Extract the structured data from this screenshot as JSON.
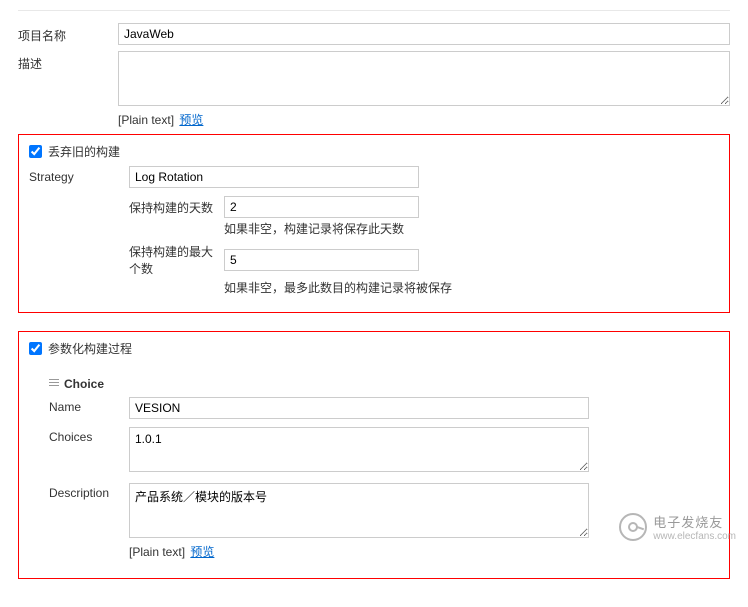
{
  "projectName": {
    "label": "项目名称",
    "value": "JavaWeb"
  },
  "description": {
    "label": "描述",
    "value": ""
  },
  "plainText": "[Plain text]",
  "previewLink": "预览",
  "discardOld": {
    "checked": true,
    "label": "丢弃旧的构建",
    "strategyLabel": "Strategy",
    "strategyValue": "Log Rotation",
    "daysKeep": {
      "label": "保持构建的天数",
      "value": "2",
      "hint": "如果非空，构建记录将保存此天数"
    },
    "maxNum": {
      "label": "保持构建的最大个数",
      "value": "5",
      "hint": "如果非空，最多此数目的构建记录将被保存"
    }
  },
  "parameterized": {
    "checked": true,
    "label": "参数化构建过程",
    "choiceTitle": "Choice",
    "name": {
      "label": "Name",
      "value": "VESION"
    },
    "choices": {
      "label": "Choices",
      "value": "1.0.1"
    },
    "descField": {
      "label": "Description",
      "value": "产品系统／模块的版本号"
    }
  },
  "watermark": {
    "brand": "电子发烧友",
    "url": "www.elecfans.com"
  }
}
